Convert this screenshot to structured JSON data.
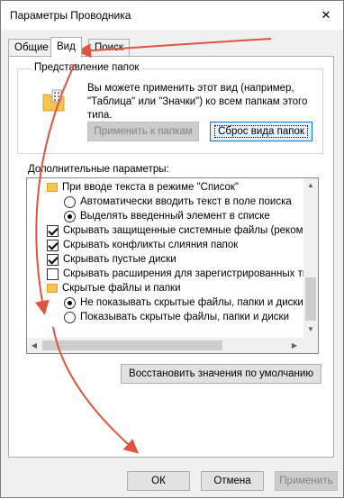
{
  "window": {
    "title": "Параметры Проводника",
    "close_glyph": "✕"
  },
  "tabs": [
    {
      "label": "Общие",
      "active": false
    },
    {
      "label": "Вид",
      "active": true
    },
    {
      "label": "Поиск",
      "active": false
    }
  ],
  "folder_views": {
    "legend": "Представление папок",
    "icon": "folder-view-icon",
    "description": "Вы можете применить этот вид (например, \"Таблица\" или \"Значки\") ко всем папкам этого типа.",
    "apply_button": "Применить к папкам",
    "reset_button": "Сброс вида папок"
  },
  "advanced": {
    "label": "Дополнительные параметры:",
    "items": [
      {
        "kind": "folder",
        "indent": 0,
        "text": "При вводе текста в режиме \"Список\""
      },
      {
        "kind": "radio",
        "indent": 1,
        "checked": false,
        "text": "Автоматически вводить текст в поле поиска"
      },
      {
        "kind": "radio",
        "indent": 1,
        "checked": true,
        "text": "Выделять введенный элемент в списке"
      },
      {
        "kind": "checkbox",
        "indent": 0,
        "checked": true,
        "text": "Скрывать защищенные системные файлы (рекомен"
      },
      {
        "kind": "checkbox",
        "indent": 0,
        "checked": true,
        "text": "Скрывать конфликты слияния папок"
      },
      {
        "kind": "checkbox",
        "indent": 0,
        "checked": true,
        "text": "Скрывать пустые диски"
      },
      {
        "kind": "checkbox",
        "indent": 0,
        "checked": false,
        "text": "Скрывать расширения для зарегистрированных типо"
      },
      {
        "kind": "folder",
        "indent": 0,
        "text": "Скрытые файлы и папки"
      },
      {
        "kind": "radio",
        "indent": 1,
        "checked": true,
        "text": "Не показывать скрытые файлы, папки и диски"
      },
      {
        "kind": "radio",
        "indent": 1,
        "checked": false,
        "text": "Показывать скрытые файлы, папки и диски"
      }
    ],
    "restore_button": "Восстановить значения по умолчанию"
  },
  "footer": {
    "ok": "ОК",
    "cancel": "Отмена",
    "apply": "Применить"
  },
  "colors": {
    "annotation_arrow": "#e0533f",
    "focus_border": "#0078d7"
  }
}
